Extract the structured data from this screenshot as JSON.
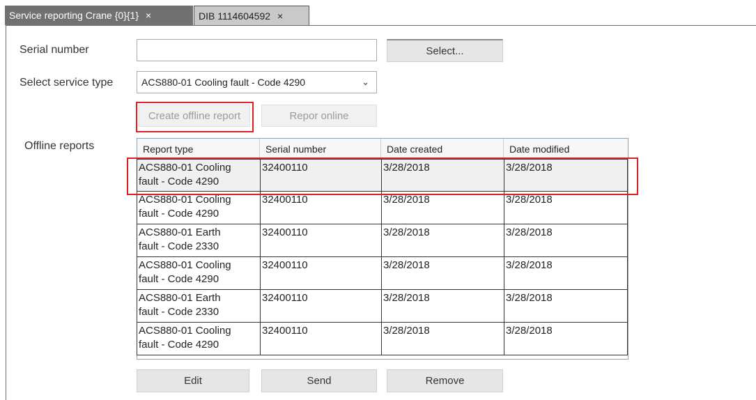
{
  "tabs": [
    {
      "label": "Service reporting Crane {0}{1}",
      "close": "×"
    },
    {
      "label": "DIB 1114604592",
      "close": "×"
    }
  ],
  "form": {
    "serial_label": "Serial number",
    "serial_value": "",
    "select_button": "Select...",
    "service_type_label": "Select service type",
    "service_type_value": "ACS880-01 Cooling fault - Code 4290",
    "create_offline_button": "Create offline report",
    "report_online_button": "Repor online",
    "offline_reports_label": "Offline reports"
  },
  "table": {
    "headers": [
      "Report type",
      "Serial number",
      "Date created",
      "Date modified"
    ],
    "rows": [
      {
        "type1": "ACS880-01 Cooling",
        "type2": "fault - Code 4290",
        "serial": "32400110",
        "created": "3/28/2018",
        "modified": "3/28/2018"
      },
      {
        "type1": "ACS880-01 Cooling",
        "type2": "fault - Code 4290",
        "serial": "32400110",
        "created": "3/28/2018",
        "modified": "3/28/2018"
      },
      {
        "type1": "ACS880-01 Earth",
        "type2": "fault - Code 2330",
        "serial": "32400110",
        "created": "3/28/2018",
        "modified": "3/28/2018"
      },
      {
        "type1": "ACS880-01 Cooling",
        "type2": "fault - Code 4290",
        "serial": "32400110",
        "created": "3/28/2018",
        "modified": "3/28/2018"
      },
      {
        "type1": "ACS880-01 Earth",
        "type2": "fault - Code 2330",
        "serial": "32400110",
        "created": "3/28/2018",
        "modified": "3/28/2018"
      },
      {
        "type1": "ACS880-01 Cooling",
        "type2": "fault - Code 4290",
        "serial": "32400110",
        "created": "3/28/2018",
        "modified": "3/28/2018"
      }
    ]
  },
  "actions": {
    "edit": "Edit",
    "send": "Send",
    "remove": "Remove"
  },
  "colors": {
    "highlight": "#e0201e",
    "active_tab": "#717171"
  }
}
